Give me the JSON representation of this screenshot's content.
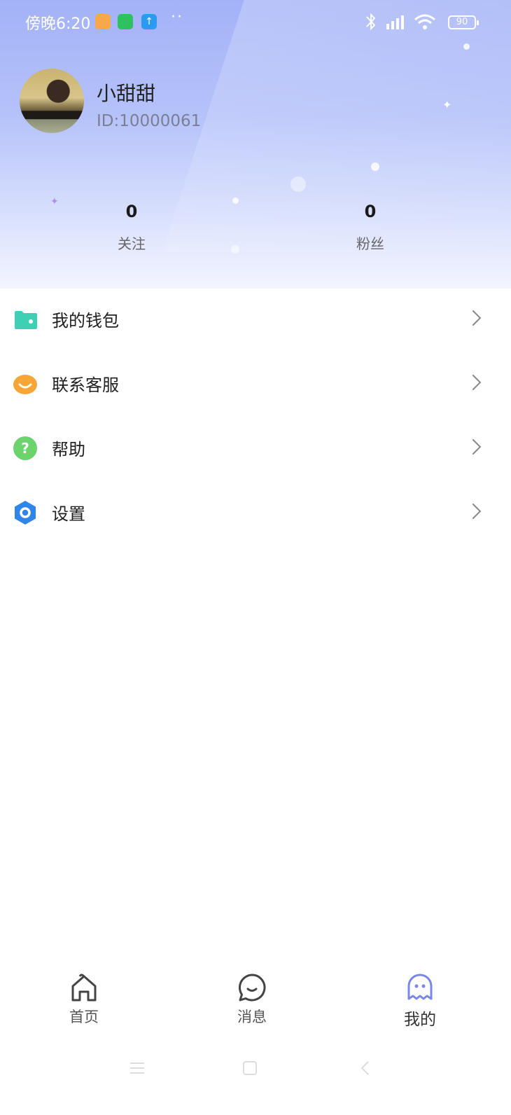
{
  "status_bar": {
    "time": "傍晚6:20",
    "dots": "··",
    "battery": "90"
  },
  "profile": {
    "name": "小甜甜",
    "id_text": "ID:10000061"
  },
  "stats": [
    {
      "value": "0",
      "label": "关注"
    },
    {
      "value": "0",
      "label": "粉丝"
    }
  ],
  "menu": [
    {
      "label": "我的钱包",
      "icon": "wallet-icon",
      "color": "#3ecfb4"
    },
    {
      "label": "联系客服",
      "icon": "customer-service-icon",
      "color": "#f7a536"
    },
    {
      "label": "帮助",
      "icon": "help-icon",
      "color": "#6dd36c"
    },
    {
      "label": "设置",
      "icon": "settings-icon",
      "color": "#2f86e8"
    }
  ],
  "bottom_nav": [
    {
      "label": "首页",
      "icon": "home-icon"
    },
    {
      "label": "消息",
      "icon": "message-icon"
    },
    {
      "label": "我的",
      "icon": "profile-ghost-icon",
      "active": true
    }
  ],
  "colors": {
    "header_gradient_top": "#a3b2f7",
    "accent_active": "#7b86e6"
  }
}
